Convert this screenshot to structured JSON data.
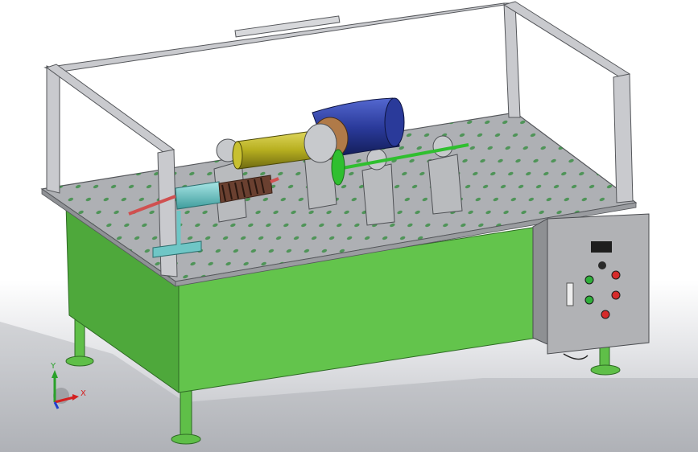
{
  "view": {
    "background_top": "#ffffff",
    "background_bottom": "#b9bbc0"
  },
  "triad": {
    "x_label": "X",
    "y_label": "Y",
    "x_color": "#d42020",
    "y_color": "#2aa12a",
    "z_color": "#1f3fcf"
  },
  "colors": {
    "frame": "#c9cace",
    "tabletop": "#aeb0b4",
    "table_base": "#5fbf48",
    "motor": "#2a3a9a",
    "shaft": "#2fbf2f",
    "pipe": "#b8b020",
    "bearing": "#c7c9cc",
    "control_box": "#b1b2b5",
    "spring": "#6a4030",
    "sleeve": "#6fc6c6",
    "coupling": "#b07a48"
  },
  "control_panel": {
    "indicators": [
      "green",
      "red",
      "green",
      "red",
      "red"
    ]
  }
}
